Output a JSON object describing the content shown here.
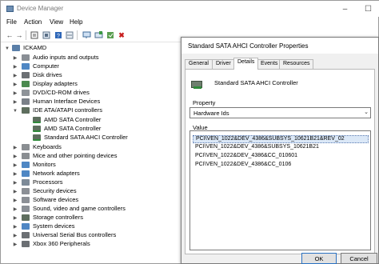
{
  "device_manager": {
    "title": "Device Manager",
    "menu": [
      "File",
      "Action",
      "View",
      "Help"
    ],
    "toolbar_icons": [
      "back-arrow-icon",
      "forward-arrow-icon",
      "properties-icon",
      "show-hidden-icon",
      "help-icon",
      "scan-icon",
      "update-driver-icon",
      "display-icon",
      "enable-device-icon",
      "uninstall-icon"
    ],
    "tree": {
      "root": "ICKAMD",
      "items": [
        "Audio inputs and outputs",
        "Computer",
        "Disk drives",
        "Display adapters",
        "DVD/CD-ROM drives",
        "Human Interface Devices",
        "IDE ATA/ATAPI controllers",
        "AMD SATA Controller",
        "AMD SATA Controller",
        "Standard SATA AHCI Controller",
        "Keyboards",
        "Mice and other pointing devices",
        "Monitors",
        "Network adapters",
        "Processors",
        "Security devices",
        "Software devices",
        "Sound, video and game controllers",
        "Storage controllers",
        "System devices",
        "Universal Serial Bus controllers",
        "Xbox 360 Peripherals"
      ]
    }
  },
  "properties_dialog": {
    "title": "Standard SATA AHCI Controller Properties",
    "tabs": [
      "General",
      "Driver",
      "Details",
      "Events",
      "Resources"
    ],
    "active_tab": "Details",
    "device_name": "Standard SATA AHCI Controller",
    "property_label": "Property",
    "property_value": "Hardware Ids",
    "value_label": "Value",
    "values": [
      "PCI\\VEN_1022&DEV_4386&SUBSYS_10621B21&REV_02",
      "PCI\\VEN_1022&DEV_4386&SUBSYS_10621B21",
      "PCI\\VEN_1022&DEV_4386&CC_010601",
      "PCI\\VEN_1022&DEV_4386&CC_0106"
    ],
    "ok_label": "OK",
    "cancel_label": "Cancel"
  },
  "colors": {
    "selection": "#dbe8f7",
    "primary_border": "#2b72c2"
  }
}
